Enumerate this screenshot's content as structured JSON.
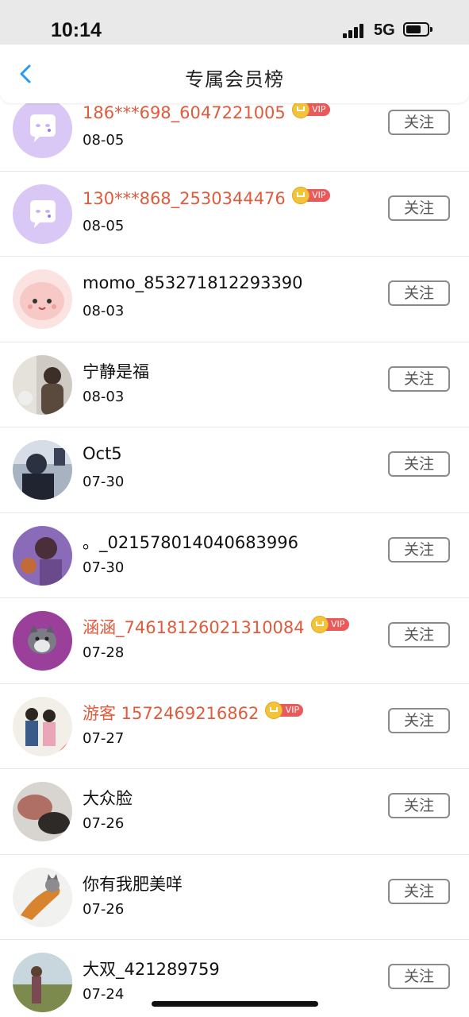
{
  "status_bar": {
    "time": "10:14",
    "network": "5G"
  },
  "header": {
    "title": "专属会员榜"
  },
  "members": [
    {
      "name": "186***698_6047221005",
      "date": "08-05",
      "vip": true,
      "vip_label": "VIP",
      "avatar": "default-chat-avatar",
      "follow_label": "关注"
    },
    {
      "name": "130***868_2530344476",
      "date": "08-05",
      "vip": true,
      "vip_label": "VIP",
      "avatar": "default-chat-avatar",
      "follow_label": "关注"
    },
    {
      "name": "momo_853271812293390",
      "date": "08-03",
      "vip": false,
      "avatar": "pink-cartoon",
      "follow_label": "关注"
    },
    {
      "name": "宁静是福",
      "date": "08-03",
      "vip": false,
      "avatar": "child-photo",
      "follow_label": "关注"
    },
    {
      "name": "Oct5",
      "date": "07-30",
      "vip": false,
      "avatar": "person-photo",
      "follow_label": "关注"
    },
    {
      "name": "。_021578014040683996",
      "date": "07-30",
      "vip": false,
      "avatar": "purple-photo",
      "follow_label": "关注"
    },
    {
      "name": "涵涵_7461812602131008​4",
      "date": "07-28",
      "vip": true,
      "vip_label": "VIP",
      "avatar": "plush-toy-photo",
      "follow_label": "关注"
    },
    {
      "name": "游客 1572469216862",
      "date": "07-27",
      "vip": true,
      "vip_label": "VIP",
      "avatar": "kids-photo",
      "follow_label": "关注"
    },
    {
      "name": "大众脸",
      "date": "07-26",
      "vip": false,
      "avatar": "blurred-photo",
      "follow_label": "关注"
    },
    {
      "name": "你有我肥美咩",
      "date": "07-26",
      "vip": false,
      "avatar": "cat-food-photo",
      "follow_label": "关注"
    },
    {
      "name": "大双_421289759",
      "date": "07-24",
      "vip": false,
      "avatar": "landscape-photo",
      "follow_label": "关注"
    }
  ],
  "colors": {
    "vip_name": "#e05a3c",
    "accent": "#2b9af3"
  }
}
